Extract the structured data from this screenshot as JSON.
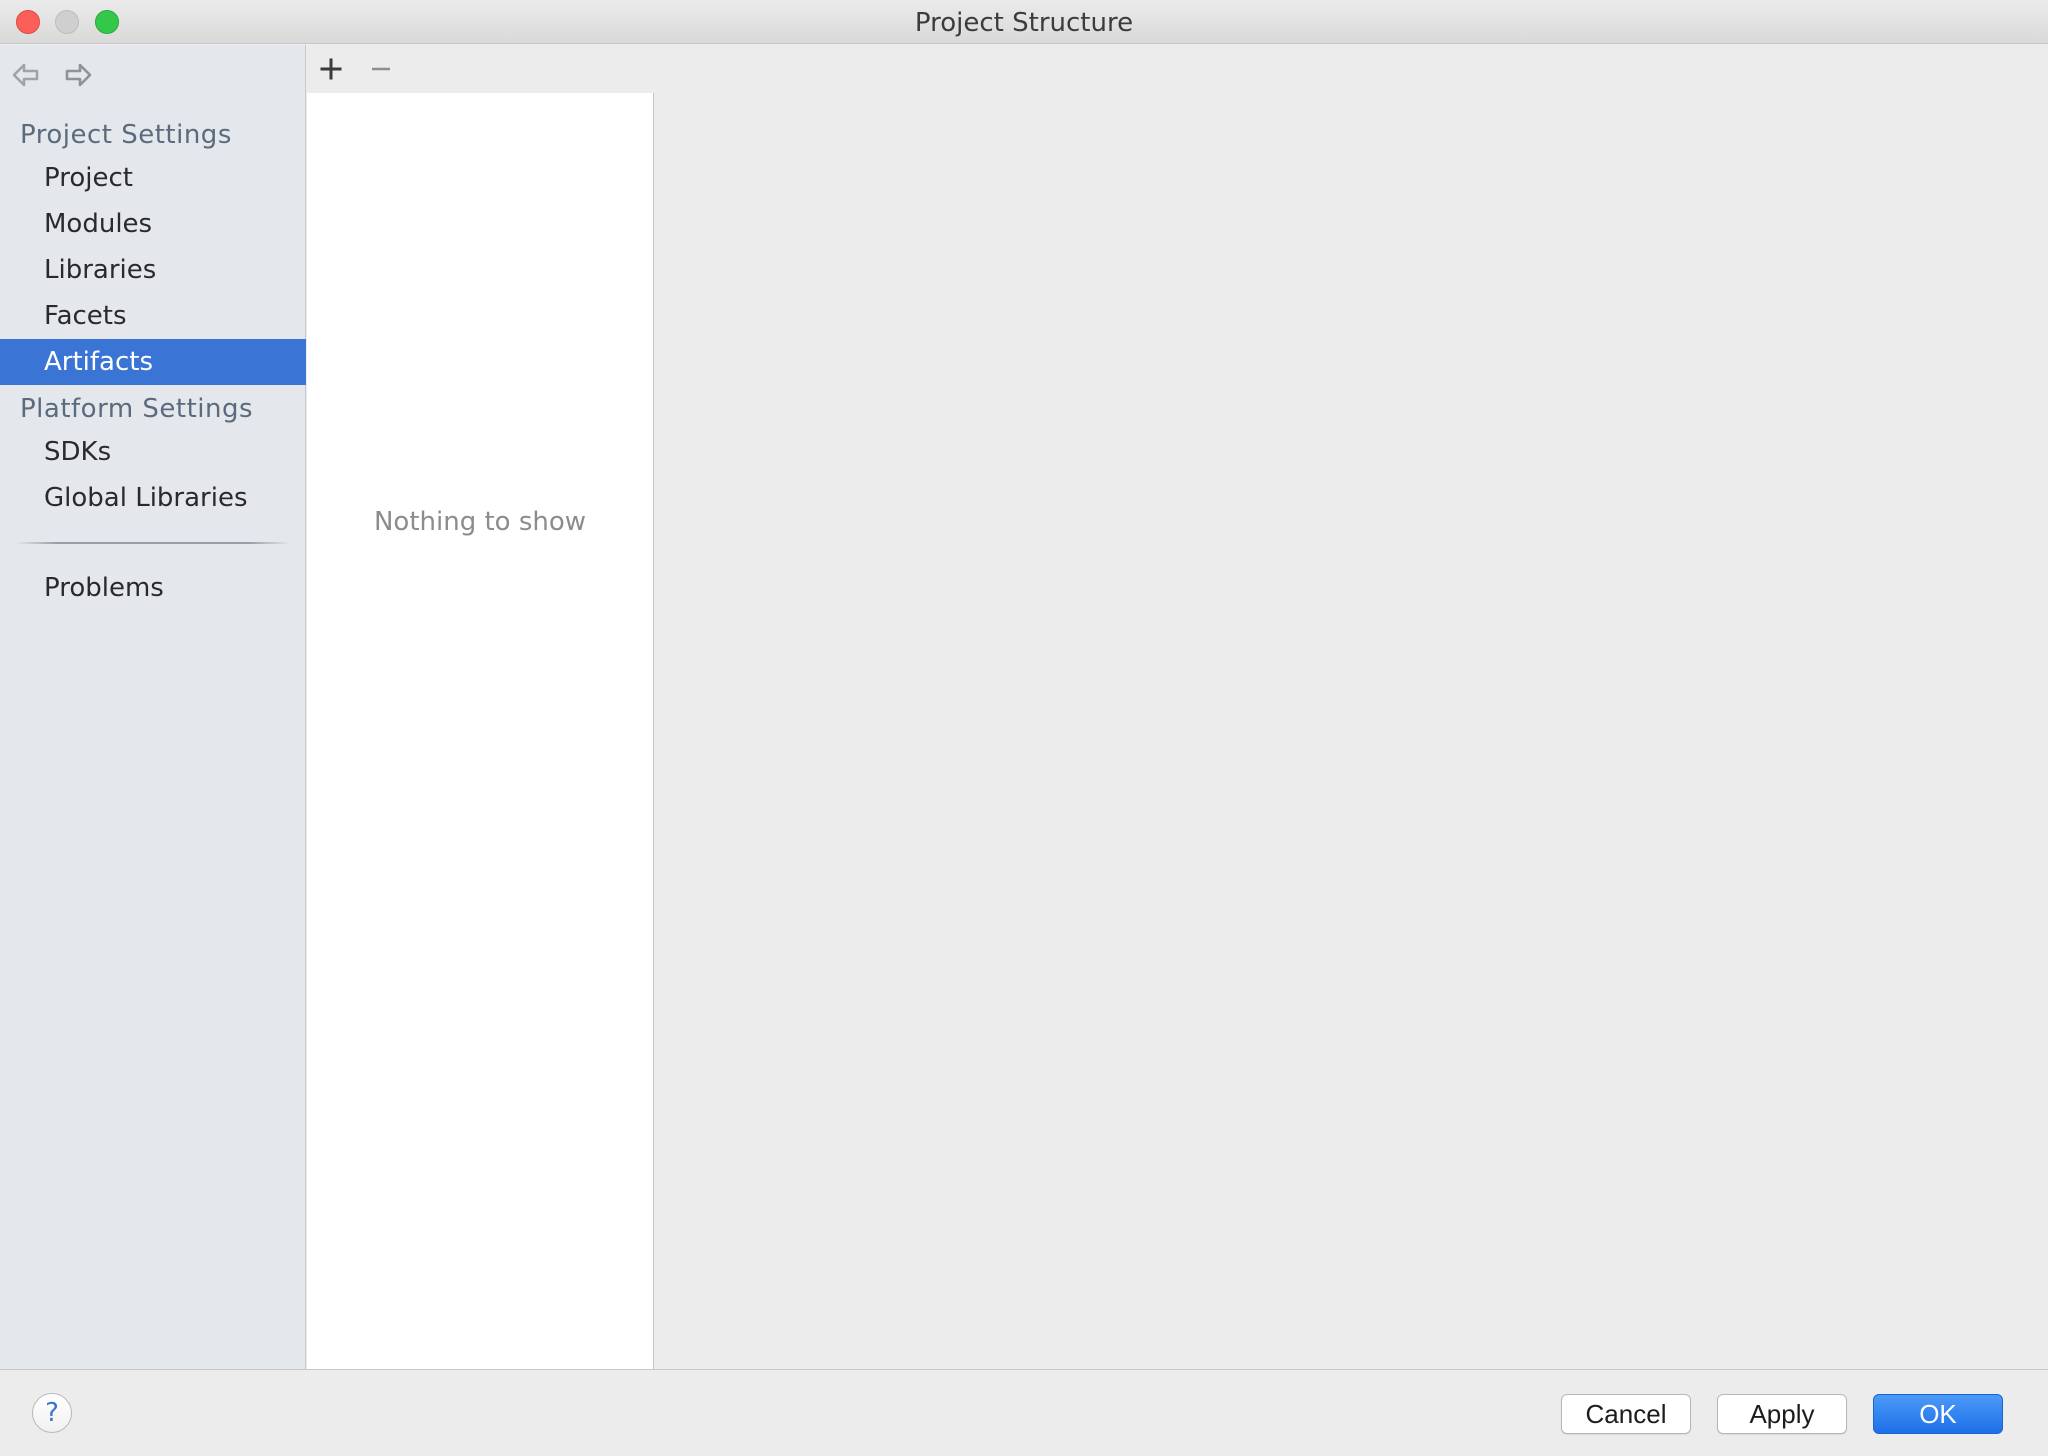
{
  "window": {
    "title": "Project Structure"
  },
  "sidebar": {
    "nav": {
      "back_icon": "back-arrow-icon",
      "forward_icon": "forward-arrow-icon"
    },
    "project_settings": {
      "header": "Project Settings",
      "items": [
        {
          "label": "Project"
        },
        {
          "label": "Modules"
        },
        {
          "label": "Libraries"
        },
        {
          "label": "Facets"
        },
        {
          "label": "Artifacts",
          "selected": true
        }
      ]
    },
    "platform_settings": {
      "header": "Platform Settings",
      "items": [
        {
          "label": "SDKs"
        },
        {
          "label": "Global Libraries"
        }
      ]
    },
    "problems": {
      "label": "Problems"
    }
  },
  "list_panel": {
    "add_icon": "plus-icon",
    "remove_icon": "minus-icon",
    "empty_text": "Nothing to show"
  },
  "footer": {
    "help_label": "?",
    "cancel_label": "Cancel",
    "apply_label": "Apply",
    "ok_label": "OK"
  },
  "colors": {
    "selection": "#3a75d6",
    "sidebar_bg": "#e4e8ed",
    "ok_button": "#1d6fe9",
    "section_header": "#5b6b7d"
  }
}
